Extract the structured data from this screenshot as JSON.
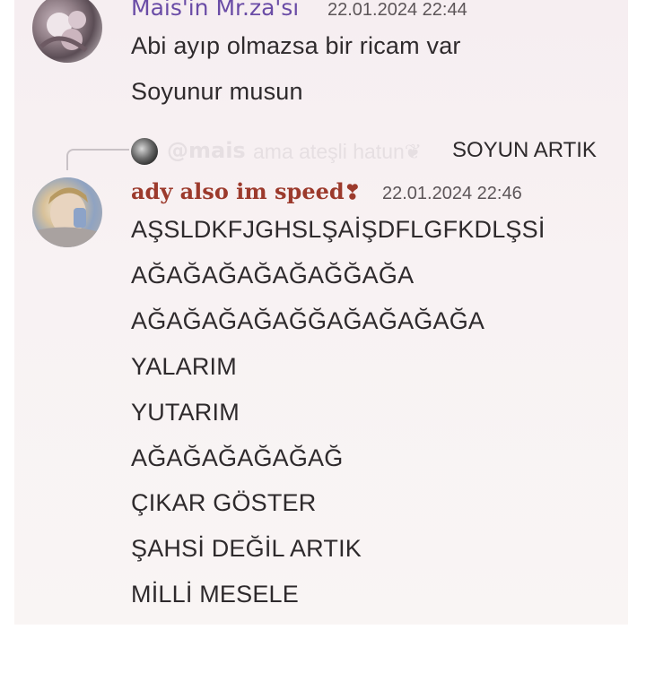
{
  "message_1": {
    "username": "Mais'in Mr.za'sı",
    "timestamp": "22.01.2024 22:44",
    "lines": [
      "Abi ayıp olmazsa bir ricam var",
      "Soyunur musun"
    ]
  },
  "reply": {
    "mention": "@mais",
    "faded_text": "ama ateşli hatun❦",
    "text": "SOYUN ARTIK"
  },
  "message_2": {
    "username": "ady also im speed",
    "username_icon": "heart-emoji",
    "timestamp": "22.01.2024 22:46",
    "lines": [
      "AŞSLDKFJGHSLŞAİŞDFLGFKDLŞSİ",
      "AĞAĞAĞAĞAĞAĞĞAĞA",
      "AĞAĞAĞAĞAĞĞAĞAĞAĞAĞA",
      "YALARIM",
      "YUTARIM",
      "AĞAĞAĞAĞAĞAĞ",
      "ÇIKAR GÖSTER",
      "ŞAHSİ DEĞİL ARTIK",
      "MİLLİ MESELE"
    ]
  },
  "colors": {
    "username_1": "#6a4ca6",
    "username_2": "#9c3a2c",
    "text": "#2e2a2c",
    "timestamp": "#5c5558"
  }
}
